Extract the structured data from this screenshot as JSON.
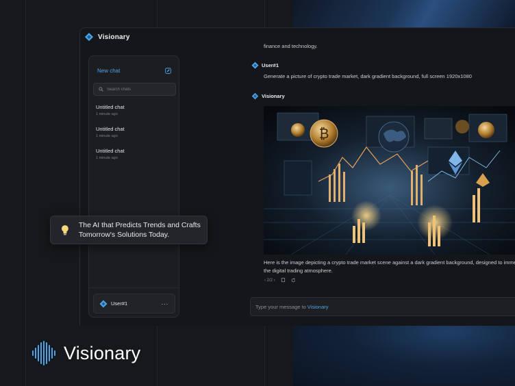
{
  "app": {
    "brand_name": "Visionary",
    "accent_color": "#4fa3e8"
  },
  "sidebar": {
    "new_chat_label": "New chat",
    "search_placeholder": "Search chats",
    "chats": [
      {
        "title": "Untitled chat",
        "time": "1 minute ago"
      },
      {
        "title": "Untitled chat",
        "time": "1 minute ago"
      },
      {
        "title": "Untitled chat",
        "time": "1 minute ago"
      }
    ],
    "user": {
      "name": "User#1",
      "more_label": "···"
    }
  },
  "conversation": {
    "truncated_line": "finance and technology.",
    "user_message": {
      "author": "User#1",
      "text": "Generate a picture of crypto trade market, dark gradient background, full screen 1920x1080"
    },
    "assistant_message": {
      "author": "Visionary",
      "caption_line1": "Here is the image depicting a crypto trade market scene against a dark gradient background, designed to immerse",
      "caption_line2": "the digital trading atmosphere.",
      "pager": "‹ 2/2 ›",
      "image_icon": "crypto-market-illustration"
    }
  },
  "composer": {
    "placeholder_prefix": "Type your message to",
    "placeholder_accent": "Visionary"
  },
  "tooltip": {
    "line1": "The AI that Predicts Trends and Crafts",
    "line2": "Tomorrow's Solutions Today.",
    "icon": "lightbulb-icon"
  },
  "footer_brand": {
    "word": "Visionary",
    "icon": "soundwave-logo-icon"
  }
}
